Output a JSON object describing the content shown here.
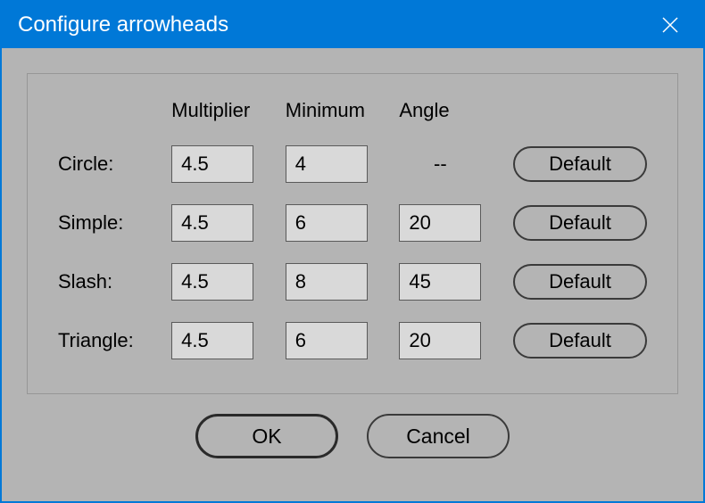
{
  "window": {
    "title": "Configure arrowheads"
  },
  "headers": {
    "multiplier": "Multiplier",
    "minimum": "Minimum",
    "angle": "Angle"
  },
  "rows": [
    {
      "label": "Circle:",
      "multiplier": "4.5",
      "minimum": "4",
      "angle": null,
      "default_label": "Default"
    },
    {
      "label": "Simple:",
      "multiplier": "4.5",
      "minimum": "6",
      "angle": "20",
      "default_label": "Default"
    },
    {
      "label": "Slash:",
      "multiplier": "4.5",
      "minimum": "8",
      "angle": "45",
      "default_label": "Default"
    },
    {
      "label": "Triangle:",
      "multiplier": "4.5",
      "minimum": "6",
      "angle": "20",
      "default_label": "Default"
    }
  ],
  "angle_placeholder": "--",
  "buttons": {
    "ok": "OK",
    "cancel": "Cancel"
  }
}
